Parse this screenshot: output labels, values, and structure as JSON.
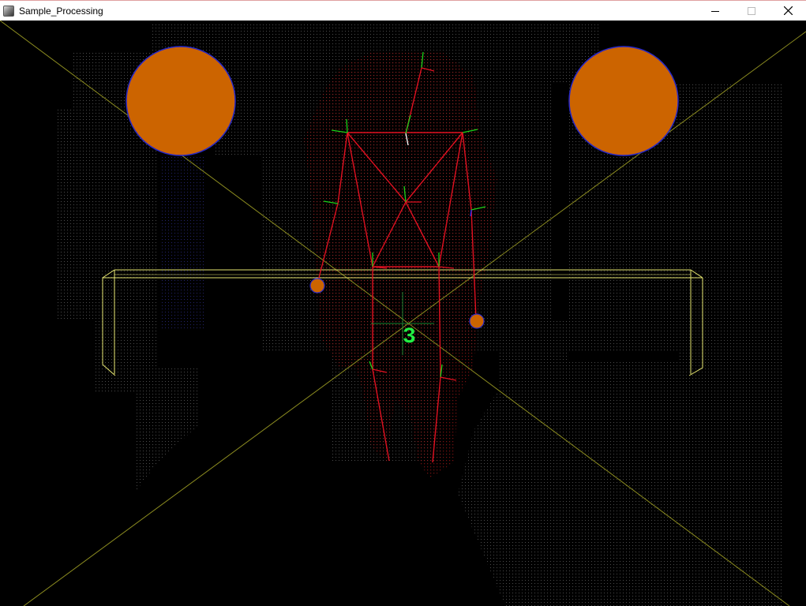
{
  "window": {
    "title": "Sample_Processing",
    "icon": "app-icon",
    "controls": [
      "minimize-icon",
      "maximize-icon",
      "close-icon"
    ]
  },
  "scene": {
    "user_id_label": "3",
    "colors": {
      "skeleton": "#e01020",
      "joint_axis_green": "#19d219",
      "joint_axis_blue": "#2a2aff",
      "targets": "#cc6400",
      "target_outline": "#2828c8",
      "frame": "#e6e670",
      "diagonals": "#8c8c20",
      "point_cloud": "#8a8a8a",
      "body_cloud": "#5a0c0c",
      "label": "#22ee44"
    }
  }
}
